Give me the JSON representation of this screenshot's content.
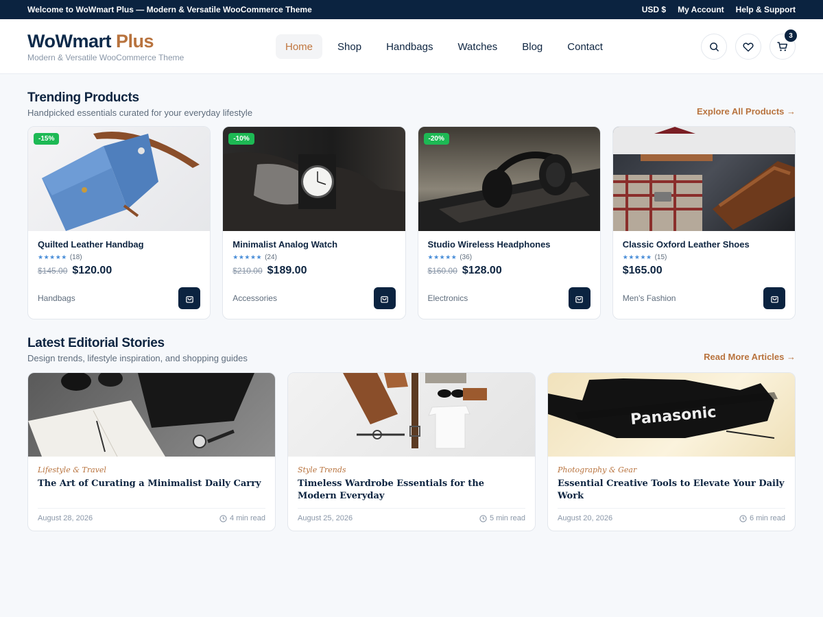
{
  "topbar": {
    "welcome": "Welcome to WoWmart Plus — Modern & Versatile WooCommerce Theme",
    "currency": "USD $",
    "account": "My Account",
    "help": "Help & Support"
  },
  "brand": {
    "name_main": "WoWmart",
    "name_accent": "Plus",
    "tagline": "Modern & Versatile WooCommerce Theme"
  },
  "nav": [
    "Home",
    "Shop",
    "Handbags",
    "Watches",
    "Blog",
    "Contact"
  ],
  "cart_count": "3",
  "icons": {
    "search": "search-icon",
    "wishlist": "heart-icon",
    "cart": "cart-icon"
  },
  "trending": {
    "title": "Trending Products",
    "subtitle": "Handpicked essentials curated for your everyday lifestyle",
    "link": "Explore All Products →",
    "products": [
      {
        "name": "Quilted Leather Handbag",
        "stars": "★★★★★",
        "reviews": "(18)",
        "old_price": "$145.00",
        "price": "$120.00",
        "category": "Handbags",
        "badge": "-15%"
      },
      {
        "name": "Minimalist Analog Watch",
        "stars": "★★★★★",
        "reviews": "(24)",
        "old_price": "$210.00",
        "price": "$189.00",
        "category": "Accessories",
        "badge": "-10%"
      },
      {
        "name": "Studio Wireless Headphones",
        "stars": "★★★★★",
        "reviews": "(36)",
        "old_price": "$160.00",
        "price": "$128.00",
        "category": "Electronics",
        "badge": "-20%"
      },
      {
        "name": "Classic Oxford Leather Shoes",
        "stars": "★★★★★",
        "reviews": "(15)",
        "old_price": "",
        "price": "$165.00",
        "category": "Men's Fashion",
        "badge": ""
      }
    ]
  },
  "editorial": {
    "title": "Latest Editorial Stories",
    "subtitle": "Design trends, lifestyle inspiration, and shopping guides",
    "link": "Read More Articles →",
    "posts": [
      {
        "category": "Lifestyle & Travel",
        "title": "The Art of Curating a Minimalist Daily Carry",
        "date": "August 28, 2026",
        "read": "4 min read"
      },
      {
        "category": "Style Trends",
        "title": "Timeless Wardrobe Essentials for the Modern Everyday",
        "date": "August 25, 2026",
        "read": "5 min read"
      },
      {
        "category": "Photography & Gear",
        "title": "Essential Creative Tools to Elevate Your Daily Work",
        "date": "August 20, 2026",
        "read": "6 min read",
        "image_text": "Panasonic"
      }
    ]
  },
  "colors": {
    "navy": "#0b2340",
    "accent": "#b8733e",
    "sale_badge": "#1db954",
    "star": "#4a8ed8"
  }
}
